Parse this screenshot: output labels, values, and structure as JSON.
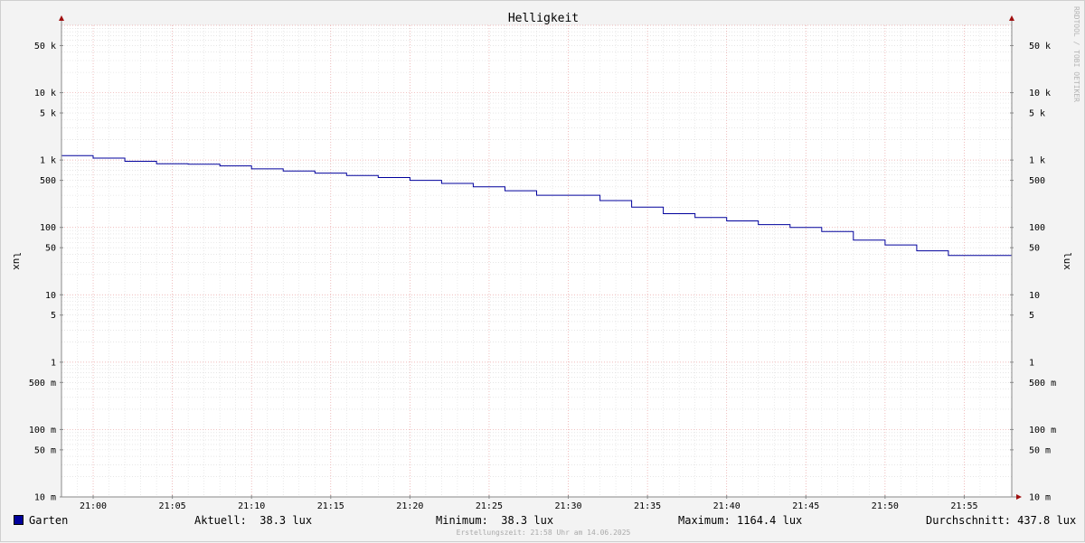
{
  "chart_data": {
    "type": "line",
    "title": "Helligkeit",
    "ylabel": "lux",
    "yscale": "log",
    "ylim": [
      0.01,
      100000
    ],
    "xlim": [
      "20:58",
      "21:58"
    ],
    "grid": true,
    "x_ticks": [
      "21:00",
      "21:05",
      "21:10",
      "21:15",
      "21:20",
      "21:25",
      "21:30",
      "21:35",
      "21:40",
      "21:45",
      "21:50",
      "21:55"
    ],
    "y_ticks": [
      {
        "value": 50000,
        "label": "50 k"
      },
      {
        "value": 10000,
        "label": "10 k"
      },
      {
        "value": 5000,
        "label": "5 k"
      },
      {
        "value": 1000,
        "label": "1 k"
      },
      {
        "value": 500,
        "label": "500"
      },
      {
        "value": 100,
        "label": "100"
      },
      {
        "value": 50,
        "label": "50"
      },
      {
        "value": 10,
        "label": "10"
      },
      {
        "value": 5,
        "label": "5"
      },
      {
        "value": 1,
        "label": "1"
      },
      {
        "value": 0.5,
        "label": "500 m"
      },
      {
        "value": 0.1,
        "label": "100 m"
      },
      {
        "value": 0.05,
        "label": "50 m"
      },
      {
        "value": 0.01,
        "label": "10 m"
      }
    ],
    "series": [
      {
        "name": "Garten",
        "color": "#00009c",
        "step": true,
        "x": [
          "20:58",
          "21:00",
          "21:02",
          "21:04",
          "21:06",
          "21:08",
          "21:10",
          "21:12",
          "21:14",
          "21:16",
          "21:18",
          "21:20",
          "21:22",
          "21:24",
          "21:26",
          "21:28",
          "21:30",
          "21:32",
          "21:34",
          "21:36",
          "21:38",
          "21:40",
          "21:42",
          "21:44",
          "21:46",
          "21:48",
          "21:50",
          "21:52",
          "21:54",
          "21:56"
        ],
        "values": [
          1164.4,
          1070,
          960,
          880,
          870,
          820,
          740,
          690,
          640,
          590,
          550,
          500,
          450,
          400,
          350,
          300,
          300,
          250,
          200,
          160,
          140,
          125,
          110,
          100,
          87,
          65,
          55,
          45,
          38.3,
          38.3
        ]
      }
    ]
  },
  "legend": {
    "series_label": "Garten",
    "current": "Aktuell:  38.3 lux",
    "minimum": "Minimum:  38.3 lux",
    "maximum": "Maximum: 1164.4 lux",
    "average": "Durchschnitt: 437.8 lux"
  },
  "footer": "Erstellungszeit: 21:58 Uhr am 14.06.2025",
  "watermark": "RRDTOOL / TOBI OETIKER"
}
